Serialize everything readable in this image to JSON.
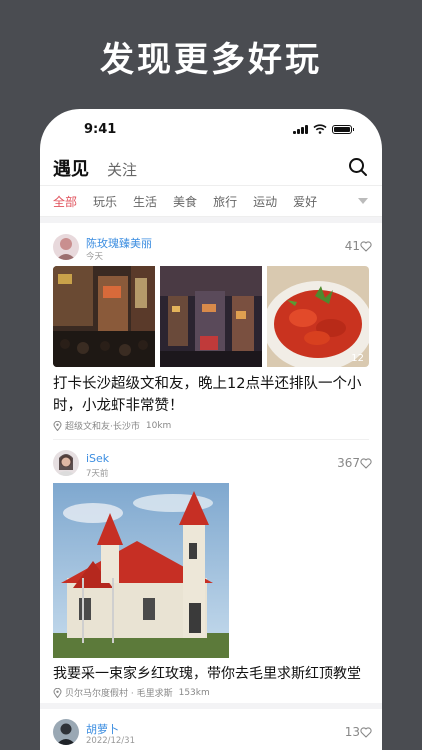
{
  "promo_title": "发现更多好玩",
  "status": {
    "time": "9:41"
  },
  "header": {
    "tab_encounter": "遇见",
    "tab_follow": "关注"
  },
  "categories": [
    "全部",
    "玩乐",
    "生活",
    "美食",
    "旅行",
    "运动",
    "爱好"
  ],
  "accent_color": "#e0525c",
  "link_color": "#3b8de0",
  "posts": [
    {
      "user": "陈玫瑰臻美丽",
      "time": "今天",
      "likes": "41",
      "image_count": "12",
      "text": "打卡长沙超级文和友，晚上12点半还排队一个小时，小龙虾非常赞！",
      "location": "超级文和友·长沙市",
      "distance": "10km"
    },
    {
      "user": "iSek",
      "time": "7天前",
      "likes": "367",
      "text": "我要采一束家乡红玫瑰，带你去毛里求斯红顶教堂",
      "location": "贝尔马尔度假村 · 毛里求斯",
      "distance": "153km"
    },
    {
      "user": "胡萝卜",
      "time": "2022/12/31",
      "likes": "13"
    }
  ]
}
